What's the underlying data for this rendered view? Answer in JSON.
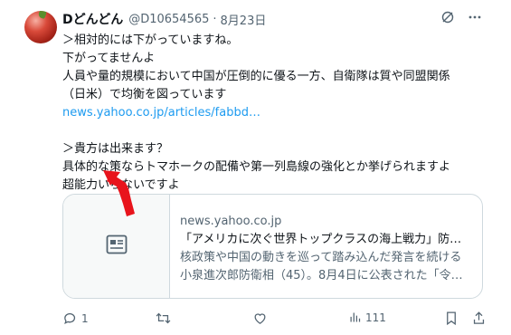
{
  "tweet": {
    "display_name": "Dどんどん",
    "handle": "@D10654565",
    "separator": "·",
    "date": "8月23日",
    "lines": [
      "＞相対的には下がっていますね。",
      "下がってませんよ",
      "人員や量的規模において中国が圧倒的に優る一方、自衛隊は質や同盟関係",
      "（日米）で均衡を図っています"
    ],
    "link": "news.yahoo.co.jp/articles/fabbd…",
    "lines2": [
      "＞貴方は出来ます？",
      "具体的な策ならトマホークの配備や第一列島線の強化とか挙げられますよ",
      "超能力いらないですよ"
    ]
  },
  "card": {
    "domain": "news.yahoo.co.jp",
    "title": "「アメリカに次ぐ世界トップクラスの海上戦力」防…",
    "desc1": "核政策や中国の動きを巡って踏み込んだ発言を続ける",
    "desc2": "小泉進次郎防衛相（45）。8月4日に公表された「令…",
    "thumb_icon": "article-icon"
  },
  "actions": {
    "reply_count": "1",
    "retweet_count": "",
    "like_count": "",
    "views_count": "111"
  },
  "colors": {
    "link": "#1d9bf0",
    "secondary": "#536471",
    "arrow": "#e8141c"
  }
}
